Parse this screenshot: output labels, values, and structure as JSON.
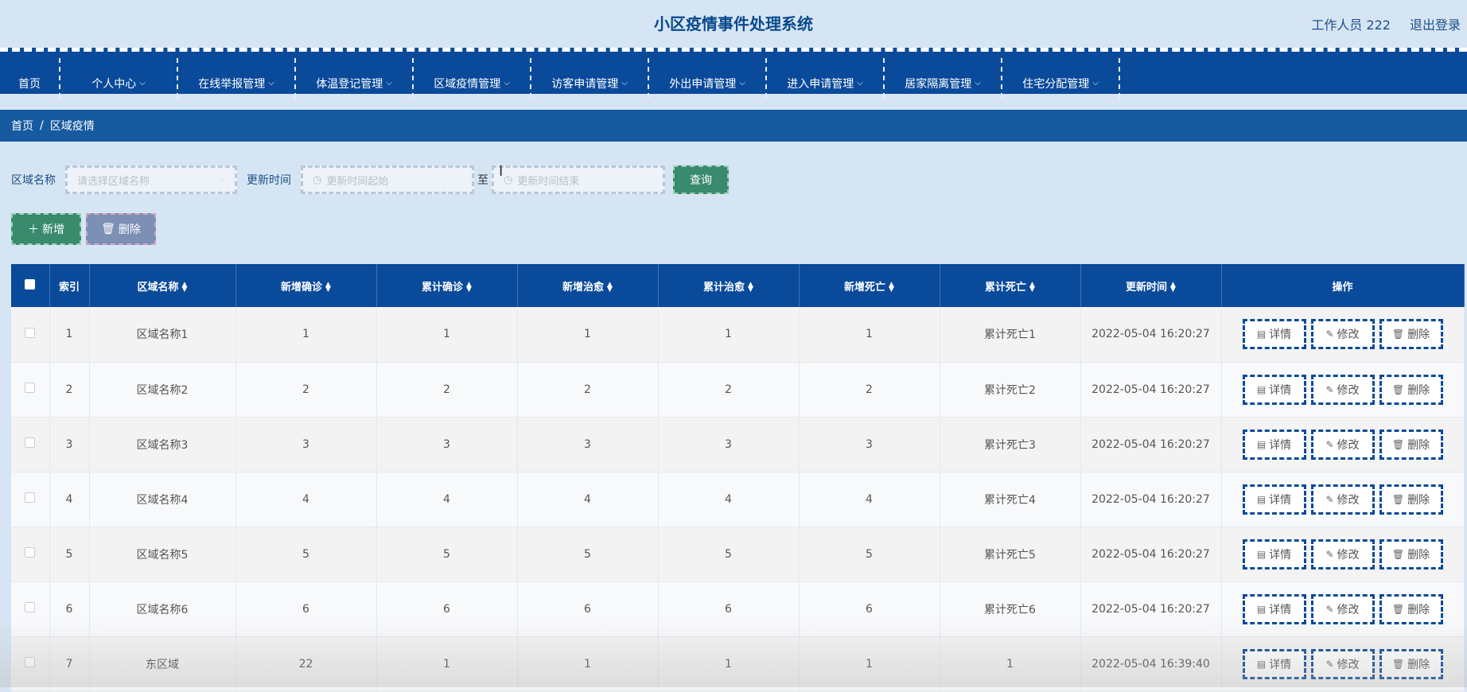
{
  "header": {
    "title": "小区疫情事件处理系统",
    "user": "工作人员 222",
    "logout": "退出登录"
  },
  "nav": [
    {
      "label": "首页",
      "dropdown": false
    },
    {
      "label": "个人中心",
      "dropdown": true
    },
    {
      "label": "在线举报管理",
      "dropdown": true
    },
    {
      "label": "体温登记管理",
      "dropdown": true
    },
    {
      "label": "区域疫情管理",
      "dropdown": true
    },
    {
      "label": "访客申请管理",
      "dropdown": true
    },
    {
      "label": "外出申请管理",
      "dropdown": true
    },
    {
      "label": "进入申请管理",
      "dropdown": true
    },
    {
      "label": "居家隔离管理",
      "dropdown": true
    },
    {
      "label": "住宅分配管理",
      "dropdown": true
    }
  ],
  "breadcrumb": {
    "home": "首页",
    "sep": "/",
    "current": "区域疫情"
  },
  "search": {
    "area_label": "区域名称",
    "area_placeholder": "请选择区域名称",
    "time_label": "更新时间",
    "start_placeholder": "更新时间起始",
    "separator": "至",
    "end_placeholder": "更新时间结束",
    "query": "查询"
  },
  "actions": {
    "add": "新增",
    "delete": "删除"
  },
  "table": {
    "columns": [
      "索引",
      "区域名称",
      "新增确诊",
      "累计确诊",
      "新增治愈",
      "累计治愈",
      "新增死亡",
      "累计死亡",
      "更新时间",
      "操作"
    ],
    "row_actions": {
      "detail": "详情",
      "edit": "修改",
      "delete": "删除"
    },
    "rows": [
      [
        "1",
        "区域名称1",
        "1",
        "1",
        "1",
        "1",
        "1",
        "累计死亡1",
        "2022-05-04 16:20:27"
      ],
      [
        "2",
        "区域名称2",
        "2",
        "2",
        "2",
        "2",
        "2",
        "累计死亡2",
        "2022-05-04 16:20:27"
      ],
      [
        "3",
        "区域名称3",
        "3",
        "3",
        "3",
        "3",
        "3",
        "累计死亡3",
        "2022-05-04 16:20:27"
      ],
      [
        "4",
        "区域名称4",
        "4",
        "4",
        "4",
        "4",
        "4",
        "累计死亡4",
        "2022-05-04 16:20:27"
      ],
      [
        "5",
        "区域名称5",
        "5",
        "5",
        "5",
        "5",
        "5",
        "累计死亡5",
        "2022-05-04 16:20:27"
      ],
      [
        "6",
        "区域名称6",
        "6",
        "6",
        "6",
        "6",
        "6",
        "累计死亡6",
        "2022-05-04 16:20:27"
      ],
      [
        "7",
        "东区域",
        "22",
        "1",
        "1",
        "1",
        "1",
        "1",
        "2022-05-04 16:39:40"
      ]
    ]
  },
  "colors": {
    "primary": "#0a4a9a",
    "success": "#3a8a6d",
    "danger": "#7c8fb4",
    "background": "#d6e5f3"
  }
}
